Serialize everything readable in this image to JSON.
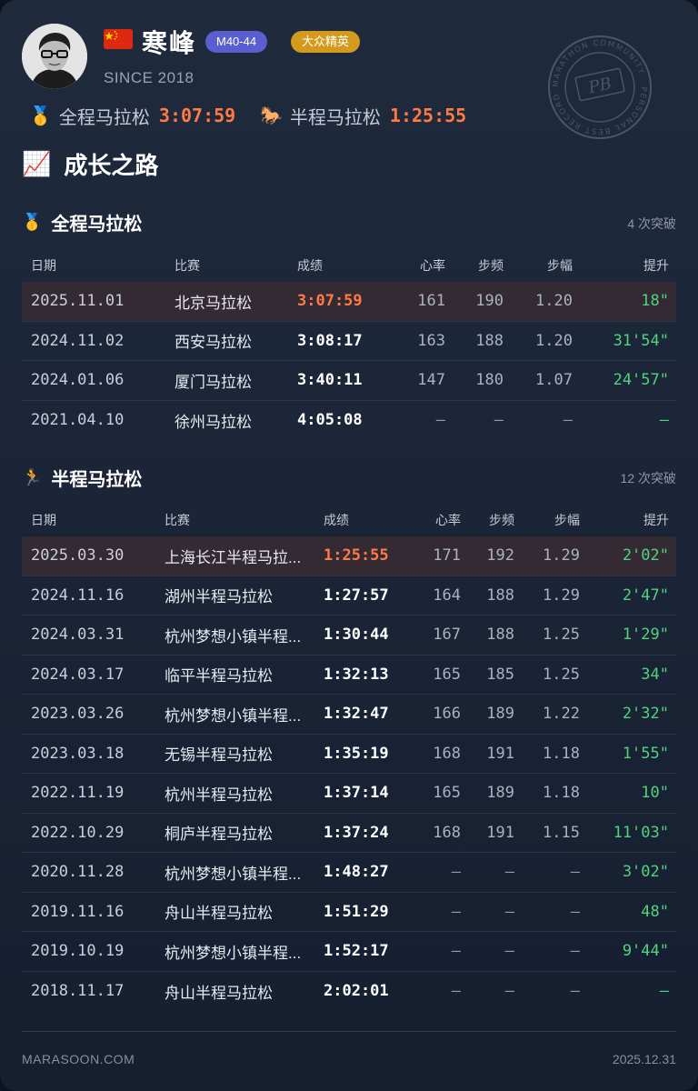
{
  "profile": {
    "name": "寒峰",
    "age_group": "M40-44",
    "level": "大众精英",
    "since": "SINCE 2018",
    "stamp_text": "MARATHON COMMUNITY · PERSONAL BEST RECORD",
    "stamp_center": "PB"
  },
  "pbs": {
    "full_label": "全程马拉松",
    "full_time": "3:07:59",
    "half_label": "半程马拉松",
    "half_time": "1:25:55"
  },
  "section_title": "成长之路",
  "columns": {
    "date": "日期",
    "race": "比赛",
    "time": "成绩",
    "hr": "心率",
    "cadence": "步频",
    "stride": "步幅",
    "improve": "提升"
  },
  "full_marathon": {
    "title": "全程马拉松",
    "count": "4 次突破",
    "rows": [
      {
        "date": "2025.11.01",
        "race": "北京马拉松",
        "time": "3:07:59",
        "hr": "161",
        "cadence": "190",
        "stride": "1.20",
        "improve": "18\""
      },
      {
        "date": "2024.11.02",
        "race": "西安马拉松",
        "time": "3:08:17",
        "hr": "163",
        "cadence": "188",
        "stride": "1.20",
        "improve": "31'54\""
      },
      {
        "date": "2024.01.06",
        "race": "厦门马拉松",
        "time": "3:40:11",
        "hr": "147",
        "cadence": "180",
        "stride": "1.07",
        "improve": "24'57\""
      },
      {
        "date": "2021.04.10",
        "race": "徐州马拉松",
        "time": "4:05:08",
        "hr": "–",
        "cadence": "–",
        "stride": "–",
        "improve": "–"
      }
    ]
  },
  "half_marathon": {
    "title": "半程马拉松",
    "count": "12 次突破",
    "rows": [
      {
        "date": "2025.03.30",
        "race": "上海长江半程马拉...",
        "time": "1:25:55",
        "hr": "171",
        "cadence": "192",
        "stride": "1.29",
        "improve": "2'02\""
      },
      {
        "date": "2024.11.16",
        "race": "湖州半程马拉松",
        "time": "1:27:57",
        "hr": "164",
        "cadence": "188",
        "stride": "1.29",
        "improve": "2'47\""
      },
      {
        "date": "2024.03.31",
        "race": "杭州梦想小镇半程...",
        "time": "1:30:44",
        "hr": "167",
        "cadence": "188",
        "stride": "1.25",
        "improve": "1'29\""
      },
      {
        "date": "2024.03.17",
        "race": "临平半程马拉松",
        "time": "1:32:13",
        "hr": "165",
        "cadence": "185",
        "stride": "1.25",
        "improve": "34\""
      },
      {
        "date": "2023.03.26",
        "race": "杭州梦想小镇半程...",
        "time": "1:32:47",
        "hr": "166",
        "cadence": "189",
        "stride": "1.22",
        "improve": "2'32\""
      },
      {
        "date": "2023.03.18",
        "race": "无锡半程马拉松",
        "time": "1:35:19",
        "hr": "168",
        "cadence": "191",
        "stride": "1.18",
        "improve": "1'55\""
      },
      {
        "date": "2022.11.19",
        "race": "杭州半程马拉松",
        "time": "1:37:14",
        "hr": "165",
        "cadence": "189",
        "stride": "1.18",
        "improve": "10\""
      },
      {
        "date": "2022.10.29",
        "race": "桐庐半程马拉松",
        "time": "1:37:24",
        "hr": "168",
        "cadence": "191",
        "stride": "1.15",
        "improve": "11'03\""
      },
      {
        "date": "2020.11.28",
        "race": "杭州梦想小镇半程...",
        "time": "1:48:27",
        "hr": "–",
        "cadence": "–",
        "stride": "–",
        "improve": "3'02\""
      },
      {
        "date": "2019.11.16",
        "race": "舟山半程马拉松",
        "time": "1:51:29",
        "hr": "–",
        "cadence": "–",
        "stride": "–",
        "improve": "48\""
      },
      {
        "date": "2019.10.19",
        "race": "杭州梦想小镇半程...",
        "time": "1:52:17",
        "hr": "–",
        "cadence": "–",
        "stride": "–",
        "improve": "9'44\""
      },
      {
        "date": "2018.11.17",
        "race": "舟山半程马拉松",
        "time": "2:02:01",
        "hr": "–",
        "cadence": "–",
        "stride": "–",
        "improve": "–"
      }
    ]
  },
  "footer": {
    "site": "MARASOON.COM",
    "date": "2025.12.31"
  },
  "colors": {
    "accent": "#ff7a45",
    "improve": "#4fd37d",
    "badge_age": "#5a5fd0",
    "badge_level": "#d49a1d"
  }
}
